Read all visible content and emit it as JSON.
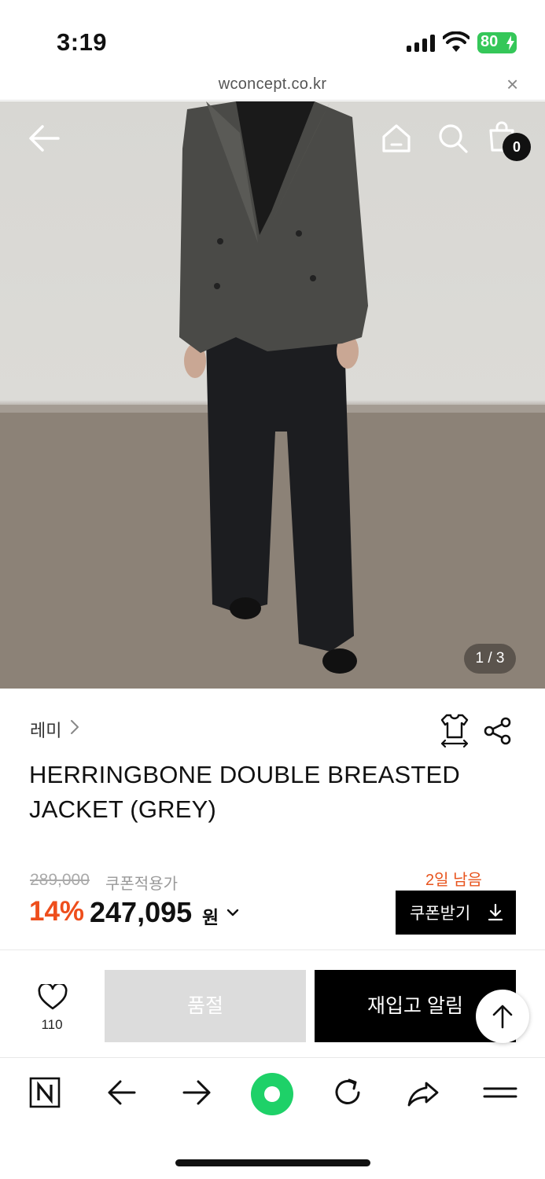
{
  "status_bar": {
    "time": "3:19",
    "battery": "80"
  },
  "url_bar": {
    "url": "wconcept.co.kr",
    "close_icon": "close-icon"
  },
  "hero": {
    "image_counter": "1 / 3",
    "cart_count": "0",
    "icons": [
      "back-arrow-icon",
      "home-icon",
      "search-icon",
      "cart-icon"
    ]
  },
  "product": {
    "brand": "레미",
    "title": "HERRINGBONE DOUBLE BREASTED JACKET (GREY)",
    "original_price": "289,000",
    "coupon_applied_label": "쿠폰적용가",
    "days_left": "2일 남음",
    "discount_rate": "14%",
    "price": "247,095",
    "currency": "원",
    "coupon_button": "쿠폰받기"
  },
  "actions": {
    "wish_count": "110",
    "soldout_label": "품절",
    "restock_label": "재입고 알림"
  },
  "toolbar": {
    "icons": [
      "naver-icon",
      "back-icon",
      "forward-icon",
      "green-dot-icon",
      "reload-icon",
      "share-arrow-icon",
      "menu-icon"
    ]
  },
  "colors": {
    "accent_discount": "#ee4e1c",
    "battery_green": "#35c759",
    "naver_green": "#1ed168"
  }
}
